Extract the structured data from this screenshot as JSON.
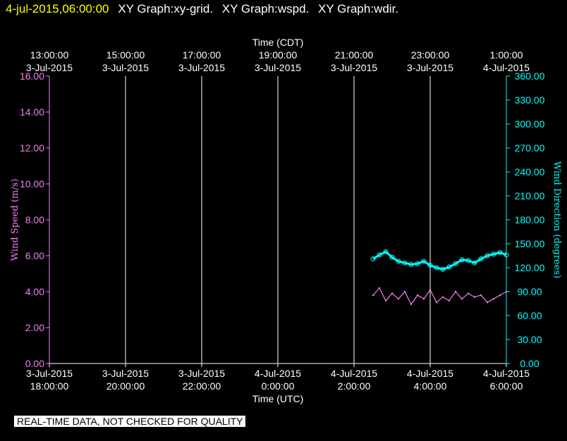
{
  "header": {
    "timestamp": "4-jul-2015,06:00:00",
    "graphs": [
      "XY Graph:xy-grid.",
      "XY Graph:wspd.",
      "XY Graph:wdir."
    ]
  },
  "footer": {
    "disclaimer": "REAL-TIME DATA, NOT CHECKED FOR QUALITY"
  },
  "colors": {
    "wspd": "#ee82ee",
    "wdir": "#00ffff",
    "grid": "#ffffff",
    "axis_x": "#ffffff"
  },
  "chart_data": {
    "type": "line",
    "top_axis": {
      "label": "Time (CDT)",
      "ticks": [
        {
          "time": "13:00:00",
          "date": "3-Jul-2015"
        },
        {
          "time": "15:00:00",
          "date": "3-Jul-2015"
        },
        {
          "time": "17:00:00",
          "date": "3-Jul-2015"
        },
        {
          "time": "19:00:00",
          "date": "3-Jul-2015"
        },
        {
          "time": "21:00:00",
          "date": "3-Jul-2015"
        },
        {
          "time": "23:00:00",
          "date": "3-Jul-2015"
        },
        {
          "time": "1:00:00",
          "date": "4-Jul-2015"
        }
      ]
    },
    "bottom_axis": {
      "label": "Time (UTC)",
      "range": [
        "2015-07-03 18:00",
        "2015-07-04 06:00"
      ],
      "ticks": [
        {
          "date": "3-Jul-2015",
          "time": "18:00:00"
        },
        {
          "date": "3-Jul-2015",
          "time": "20:00:00"
        },
        {
          "date": "3-Jul-2015",
          "time": "22:00:00"
        },
        {
          "date": "4-Jul-2015",
          "time": "0:00:00"
        },
        {
          "date": "4-Jul-2015",
          "time": "2:00:00"
        },
        {
          "date": "4-Jul-2015",
          "time": "4:00:00"
        },
        {
          "date": "4-Jul-2015",
          "time": "6:00:00"
        }
      ]
    },
    "left_axis": {
      "label": "Wind Speed (m/s)",
      "range": [
        0,
        16
      ],
      "ticks": [
        "0.00",
        "2.00",
        "4.00",
        "6.00",
        "8.00",
        "10.00",
        "12.00",
        "14.00",
        "16.00"
      ]
    },
    "right_axis": {
      "label": "Wind Direction (degrees)",
      "range": [
        0,
        360
      ],
      "ticks": [
        "0.00",
        "30.00",
        "60.00",
        "90.00",
        "120.00",
        "150.00",
        "180.00",
        "210.00",
        "240.00",
        "270.00",
        "300.00",
        "330.00",
        "360.00"
      ]
    },
    "grid": "vertical",
    "series": [
      {
        "name": "wspd",
        "axis": "left",
        "x": [
          "2015-07-04 02:30",
          "2015-07-04 02:40",
          "2015-07-04 02:50",
          "2015-07-04 03:00",
          "2015-07-04 03:10",
          "2015-07-04 03:20",
          "2015-07-04 03:30",
          "2015-07-04 03:40",
          "2015-07-04 03:50",
          "2015-07-04 04:00",
          "2015-07-04 04:10",
          "2015-07-04 04:20",
          "2015-07-04 04:30",
          "2015-07-04 04:40",
          "2015-07-04 04:50",
          "2015-07-04 05:00",
          "2015-07-04 05:10",
          "2015-07-04 05:20",
          "2015-07-04 05:30",
          "2015-07-04 05:40",
          "2015-07-04 05:50",
          "2015-07-04 06:00"
        ],
        "values": [
          3.8,
          4.2,
          3.5,
          3.9,
          3.6,
          4.0,
          3.3,
          3.8,
          3.6,
          4.1,
          3.4,
          3.7,
          3.5,
          4.0,
          3.6,
          3.9,
          3.7,
          3.8,
          3.4,
          3.6,
          3.8,
          4.0
        ]
      },
      {
        "name": "wdir",
        "axis": "right",
        "x": [
          "2015-07-04 02:30",
          "2015-07-04 02:40",
          "2015-07-04 02:50",
          "2015-07-04 03:00",
          "2015-07-04 03:10",
          "2015-07-04 03:20",
          "2015-07-04 03:30",
          "2015-07-04 03:40",
          "2015-07-04 03:50",
          "2015-07-04 04:00",
          "2015-07-04 04:10",
          "2015-07-04 04:20",
          "2015-07-04 04:30",
          "2015-07-04 04:40",
          "2015-07-04 04:50",
          "2015-07-04 05:00",
          "2015-07-04 05:10",
          "2015-07-04 05:20",
          "2015-07-04 05:30",
          "2015-07-04 05:40",
          "2015-07-04 05:50",
          "2015-07-04 06:00"
        ],
        "values": [
          131,
          136,
          140,
          133,
          128,
          126,
          124,
          125,
          128,
          123,
          120,
          118,
          121,
          125,
          130,
          129,
          126,
          131,
          135,
          137,
          139,
          136
        ]
      }
    ]
  }
}
